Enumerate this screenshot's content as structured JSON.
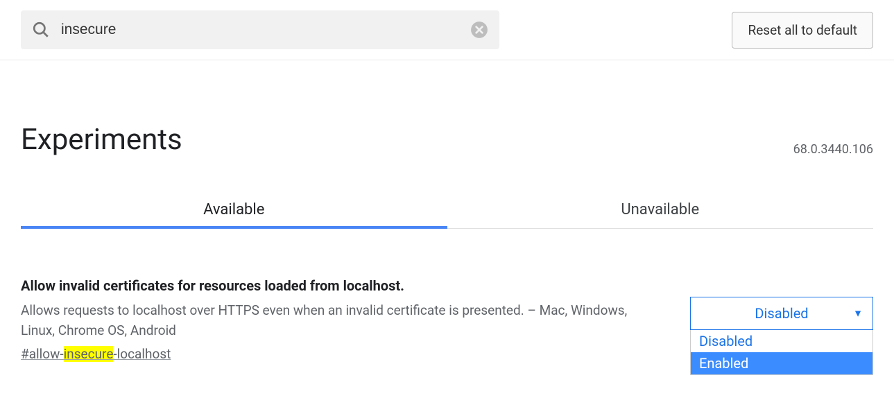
{
  "search": {
    "value": "insecure"
  },
  "reset_button_label": "Reset all to default",
  "page_title": "Experiments",
  "version": "68.0.3440.106",
  "tabs": {
    "available": "Available",
    "unavailable": "Unavailable"
  },
  "experiment": {
    "title": "Allow invalid certificates for resources loaded from localhost.",
    "description": "Allows requests to localhost over HTTPS even when an invalid certificate is presented. – Mac, Windows, Linux, Chrome OS, Android",
    "hash_pre": "#allow-",
    "hash_highlight": "insecure",
    "hash_post": "-localhost"
  },
  "dropdown": {
    "selected": "Disabled",
    "options": {
      "disabled": "Disabled",
      "enabled": "Enabled"
    }
  }
}
